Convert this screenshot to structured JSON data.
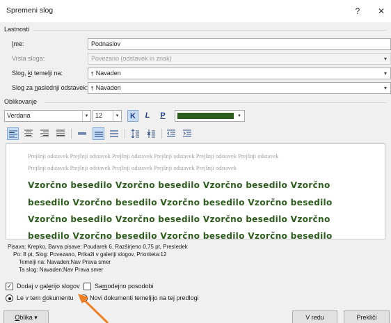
{
  "window": {
    "title": "Spremeni slog",
    "help_glyph": "?",
    "close_glyph": "✕"
  },
  "properties": {
    "section_label": "Lastnosti",
    "name": {
      "label": "Ime:",
      "value": "Podnaslov"
    },
    "style_type": {
      "label": "Vrsta sloga:",
      "value": "Povezano (odstavek in znak)"
    },
    "based_on": {
      "label": "Slog, ki temelji na:",
      "value": "Navaden"
    },
    "next_style": {
      "label": "Slog za naslednji odstavek:",
      "value": "Navaden"
    },
    "paragraph_mark": "¶"
  },
  "formatting": {
    "section_label": "Oblikovanje",
    "font": "Verdana",
    "size": "12",
    "bold_glyph": "K",
    "italic_glyph": "L",
    "underline_glyph": "P",
    "font_color": "#2e5e1e"
  },
  "preview": {
    "prev_line_1": "Prejšnji odstavek Prejšnji odstavek Prejšnji odstavek Prejšnji odstavek Prejšnji odstavek Prejšnji odstavek",
    "prev_line_2": "Prejšnji odstavek Prejšnji odstavek Prejšnji odstavek Prejšnji odstavek Prejšnji odstavek",
    "sample_1": "Vzorčno besedilo Vzorčno besedilo Vzorčno besedilo Vzorčno",
    "sample_2": "besedilo Vzorčno besedilo Vzorčno besedilo Vzorčno besedilo",
    "sample_3": "Vzorčno besedilo Vzorčno besedilo Vzorčno besedilo Vzorčno",
    "sample_4": "besedilo Vzorčno besedilo Vzorčno besedilo Vzorčno besedilo"
  },
  "description": {
    "line1": "Pisava: Krepko, Barva pisave: Poudarek 6, Razširjeno  0,75 pt, Presledek",
    "line2": "Po:  8 pt, Slog: Povezano, Prikaži v galeriji slogov, Prioriteta:12",
    "line3": "Temelji na: Navaden;Nav Prava smer",
    "line4": "Ta slog: Navaden;Nav Prava smer"
  },
  "options": {
    "add_to_gallery": {
      "label": "Dodaj v galerijo slogov",
      "checked": true
    },
    "auto_update": {
      "label": "Samodejno posodobi",
      "checked": false
    },
    "only_this_document": {
      "label": "Le v tem dokumentu",
      "selected": true
    },
    "new_documents": {
      "label": "Novi dokumenti temeljijo na tej predlogi",
      "selected": false
    }
  },
  "buttons": {
    "format": "Oblika",
    "ok": "V redu",
    "cancel": "Prekliči"
  },
  "annotation": {
    "arrow_color": "#f07f22"
  }
}
